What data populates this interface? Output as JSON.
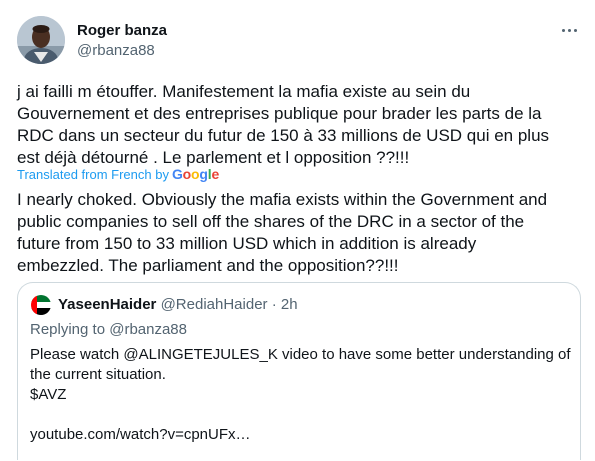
{
  "author": {
    "name": "Roger banza",
    "handle": "@rbanza88"
  },
  "tweet": {
    "text": "j ai failli m étouffer. Manifestement la mafia existe au sein du\nGouvernement et des entreprises publique pour brader les parts de la\nRDC dans un secteur du futur de 150 à 33 millions de USD qui en plus\nest déjà détourné . Le parlement et l opposition ??!!!",
    "translated_label": "Translated from French by",
    "translation_provider": "Google",
    "translation": "I nearly choked. Obviously the mafia exists within the Government and\npublic companies to sell off the shares of the DRC in a sector of the\nfuture from 150 to 33 million USD which in addition is already\nembezzled. The parliament and the opposition??!!!"
  },
  "quote": {
    "name": "YaseenHaider",
    "handle": "@RediahHaider",
    "separator": "·",
    "time": "2h",
    "replying_to_label": "Replying to",
    "replying_to_handle": "@rbanza88",
    "text": "Please watch @ALINGETEJULES_K video to have some better understanding of\nthe current situation.\n$AVZ\n\nyoutube.com/watch?v=cpnUFx…"
  },
  "icons": {
    "more": "more-horizontal-icon",
    "avatar": "user-avatar",
    "quote_avatar": "uae-flag-avatar"
  },
  "colors": {
    "link": "#1d9bf0",
    "secondary_text": "#536471",
    "border": "#cfd9de"
  }
}
